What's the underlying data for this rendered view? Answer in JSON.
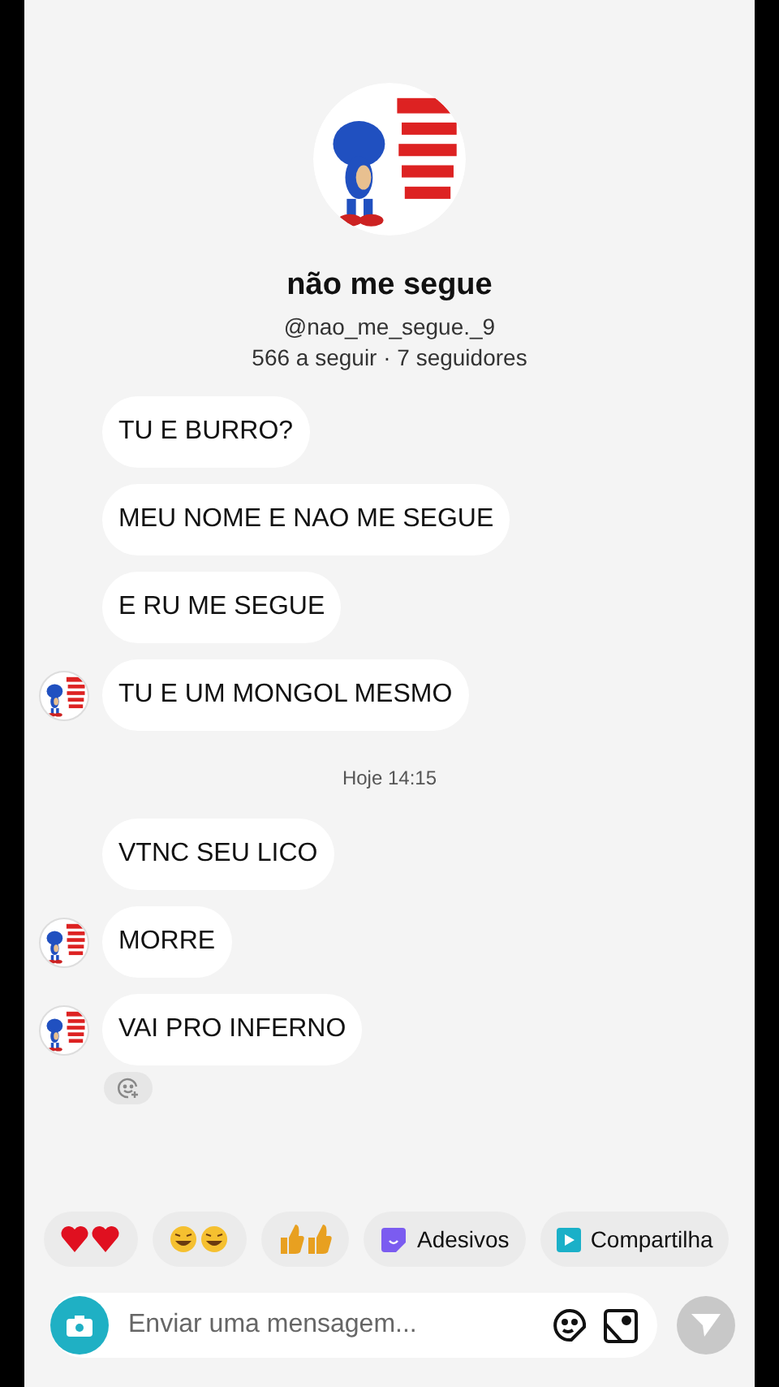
{
  "profile": {
    "name": "não me segue",
    "handle": "@nao_me_segue._9",
    "stats": "566 a seguir · 7 seguidores"
  },
  "messages": [
    {
      "kind": "message",
      "text": "TU E BURRO?",
      "show_avatar": false,
      "reaction_button": false
    },
    {
      "kind": "message",
      "text": "MEU NOME E NAO ME SEGUE",
      "show_avatar": false,
      "reaction_button": false
    },
    {
      "kind": "message",
      "text": "E RU ME SEGUE",
      "show_avatar": false,
      "reaction_button": false
    },
    {
      "kind": "message",
      "text": "TU E UM MONGOL MESMO",
      "show_avatar": true,
      "reaction_button": false
    },
    {
      "kind": "timestamp",
      "text": "Hoje 14:15"
    },
    {
      "kind": "message",
      "text": "VTNC SEU LICO",
      "show_avatar": false,
      "reaction_button": false
    },
    {
      "kind": "message",
      "text": "MORRE",
      "show_avatar": true,
      "reaction_button": false
    },
    {
      "kind": "message",
      "text": "VAI PRO INFERNO",
      "show_avatar": true,
      "reaction_button": true
    }
  ],
  "quick_replies": [
    {
      "kind": "hearts"
    },
    {
      "kind": "laughing"
    },
    {
      "kind": "thumbs"
    },
    {
      "kind": "stickers",
      "label": "Adesivos"
    },
    {
      "kind": "share",
      "label": "Compartilha"
    }
  ],
  "composer": {
    "placeholder": "Enviar uma mensagem..."
  }
}
